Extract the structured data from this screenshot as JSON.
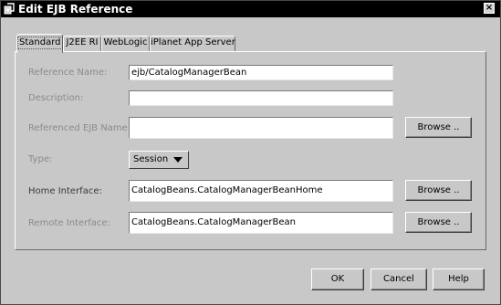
{
  "window": {
    "title": "Edit EJB Reference",
    "close_label": "×"
  },
  "tabs": [
    {
      "label": "Standard",
      "active": true
    },
    {
      "label": "J2EE RI",
      "active": false
    },
    {
      "label": "WebLogic",
      "active": false
    },
    {
      "label": "iPlanet App Server",
      "active": false
    }
  ],
  "form": {
    "reference_name": {
      "label": "Reference Name:",
      "value": "ejb/CatalogManagerBean"
    },
    "description": {
      "label": "Description:",
      "value": ""
    },
    "referenced_ejb_name": {
      "label": "Referenced EJB Name:",
      "value": ""
    },
    "type": {
      "label": "Type:",
      "value": "Session"
    },
    "home_interface": {
      "label": "Home Interface:",
      "value": "CatalogBeans.CatalogManagerBeanHome"
    },
    "remote_interface": {
      "label": "Remote Interface:",
      "value": "CatalogBeans.CatalogManagerBean"
    }
  },
  "buttons": {
    "browse": "Browse ..",
    "ok": "OK",
    "cancel": "Cancel",
    "help": "Help"
  }
}
